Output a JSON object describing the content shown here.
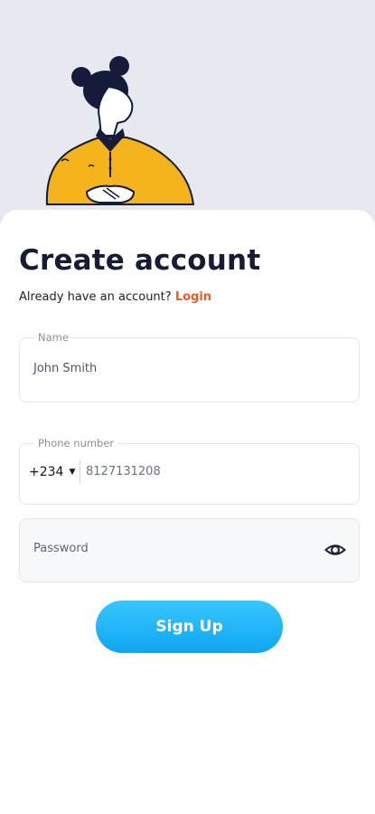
{
  "header": {
    "illustration_icon": "woman-with-folded-hands-illustration"
  },
  "form": {
    "title": "Create account",
    "login_prompt": "Already have an account?",
    "login_link": "Login",
    "name_field": {
      "label": "Name",
      "value": "John Smith"
    },
    "phone_field": {
      "label": "Phone number",
      "country_code": "+234",
      "value": "8127131208"
    },
    "password_field": {
      "placeholder": "Password",
      "toggle_icon": "eye-icon"
    },
    "submit_label": "Sign Up"
  },
  "colors": {
    "background_top": "#e6e9ef",
    "title": "#151c33",
    "link_accent": "#ee5a24",
    "button_gradient_top": "#38c7ff",
    "button_gradient_bottom": "#0fa5f0",
    "shirt": "#f5b31c"
  }
}
